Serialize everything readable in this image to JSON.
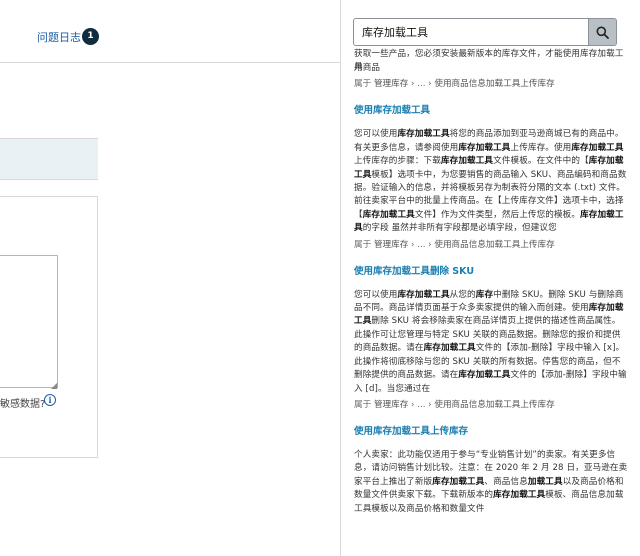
{
  "header": {
    "issue_log_label": "问题日志",
    "issue_count": "1"
  },
  "left_page": {
    "sensitive_question": "敏感数据?",
    "info_glyph": "i"
  },
  "search": {
    "value": "库存加载工具"
  },
  "results": [
    {
      "title": "",
      "snippet_top_cut": "获取一些产品，您必须安装最新版本的库存文件，才能使用库存加载工具",
      "snippet_tail": "用商品",
      "breadcrumb": {
        "prefix": "属于",
        "parent": "管理库存",
        "ellipsis": "...",
        "leaf": "使用商品信息加载工具上传库存"
      }
    },
    {
      "title": "使用库存加载工具",
      "snippet": [
        "您可以使用",
        "库存加载工具",
        "将您的商品添加到亚马逊商城已有的商品中。有关更多信息，请参阅使用",
        "库存加载工具",
        "上传库存。使用",
        "库存加载工具",
        "上传库存的步骤：下载",
        "库存加载工具",
        "文件模板。在文件中的【",
        "库存加载工具",
        "模板】选项卡中，为您要销售的商品输入 SKU、商品编码和商品数据。验证输入的信息，并将模板另存为制表符分隔的文本 (.txt) 文件。前往卖家平台中的批量上传商品。在【上传库存文件】选项卡中，选择【",
        "库存加载工具",
        "文件】作为文件类型，然后上传您的模板。",
        "库存加载工具",
        "的字段 虽然并非所有字段都是必填字段，但建议您"
      ],
      "breadcrumb": {
        "prefix": "属于",
        "parent": "管理库存",
        "ellipsis": "...",
        "leaf": "使用商品信息加载工具上传库存"
      }
    },
    {
      "title": "使用库存加载工具删除 SKU",
      "snippet": [
        "您可以使用",
        "库存加载工具",
        "从您的",
        "库存",
        "中删除 SKU。删除 SKU 与删除商品不同。商品详情页面基于众多卖家提供的输入而创建。使用",
        "库存加载工具",
        "删除 SKU 将会移除卖家在商品详情页上提供的描述性商品属性。此操作可让您管理与特定 SKU 关联的商品数据。删除您的报价和提供的商品数据。请在",
        "库存加载工具",
        "文件的【添加-删除】字段中输入 [x]。此操作将彻底移除与您的 SKU 关联的所有数据。停售您的商品，但不删除提供的商品数据。请在",
        "库存加载工具",
        "文件的【添加-删除】字段中输入 [d]。当您通过在"
      ],
      "breadcrumb": {
        "prefix": "属于",
        "parent": "管理库存",
        "ellipsis": "...",
        "leaf": "使用商品信息加载工具上传库存"
      }
    },
    {
      "title": "使用库存加载工具上传库存",
      "snippet": [
        "个人卖家：此功能仅适用于参与“专业销售计划”的卖家。有关更多信息，请访问销售计划比较。注意：在 2020 年 2 月 28 日，亚马逊在卖家平台上推出了新版",
        "库存加载工具",
        "、商品信息",
        "加载工具",
        "以及商品价格和数量文件供卖家下载。下载新版本的",
        "库存加载工具",
        "模板、商品信息加载工具模板以及商品价格和数量文件"
      ],
      "breadcrumb": null
    }
  ],
  "colors": {
    "link": "#1a7fb0",
    "badge": "#0f2d3e",
    "search_button": "#b9c0c5"
  },
  "icons": {
    "search": "search-icon",
    "info": "info-icon"
  }
}
